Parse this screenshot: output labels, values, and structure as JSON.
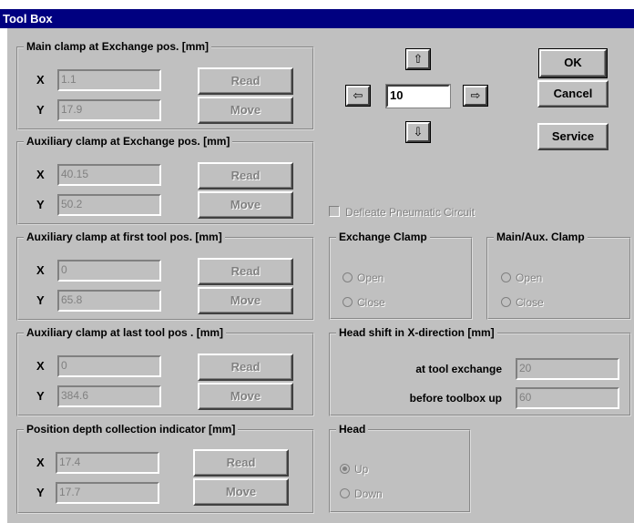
{
  "window": {
    "title": "Tool Box"
  },
  "groups": {
    "main_clamp": {
      "title": "Main clamp at Exchange pos. [mm]",
      "x_label": "X",
      "y_label": "Y",
      "x": "1.1",
      "y": "17.9",
      "read": "Read",
      "move": "Move"
    },
    "aux_exchange": {
      "title": "Auxiliary clamp at Exchange pos. [mm]",
      "x_label": "X",
      "y_label": "Y",
      "x": "40.15",
      "y": "50.2",
      "read": "Read",
      "move": "Move"
    },
    "aux_first": {
      "title": "Auxiliary clamp at first tool pos. [mm]",
      "x_label": "X",
      "y_label": "Y",
      "x": "0",
      "y": "65.8",
      "read": "Read",
      "move": "Move"
    },
    "aux_last": {
      "title": "Auxiliary clamp at last tool pos . [mm]",
      "x_label": "X",
      "y_label": "Y",
      "x": "0",
      "y": "384.6",
      "read": "Read",
      "move": "Move"
    },
    "depth": {
      "title": "Position depth collection indicator [mm]",
      "x_label": "X",
      "y_label": "Y",
      "x": "17.4",
      "y": "17.7",
      "read": "Read",
      "move": "Move"
    }
  },
  "jog": {
    "step_value": "10",
    "up_icon": "arrow-up-icon",
    "down_icon": "arrow-down-icon",
    "left_icon": "arrow-left-icon",
    "right_icon": "arrow-right-icon"
  },
  "buttons": {
    "ok": "OK",
    "cancel": "Cancel",
    "service": "Service"
  },
  "deflate": {
    "label": "Defleate Pneumatic Circuit",
    "checked": false
  },
  "exchange_clamp": {
    "title": "Exchange Clamp",
    "open": "Open",
    "close": "Close"
  },
  "main_aux_clamp": {
    "title": "Main/Aux. Clamp",
    "open": "Open",
    "close": "Close"
  },
  "head_shift": {
    "title": "Head shift in X-direction [mm]",
    "at_exchange_label": "at tool exchange",
    "at_exchange_value": "20",
    "before_up_label": "before toolbox up",
    "before_up_value": "60"
  },
  "head": {
    "title": "Head",
    "up": "Up",
    "down": "Down",
    "selected": "Up"
  },
  "colors": {
    "titlebar": "#000080",
    "face": "#c0c0c0",
    "disabled_text": "#808080"
  }
}
